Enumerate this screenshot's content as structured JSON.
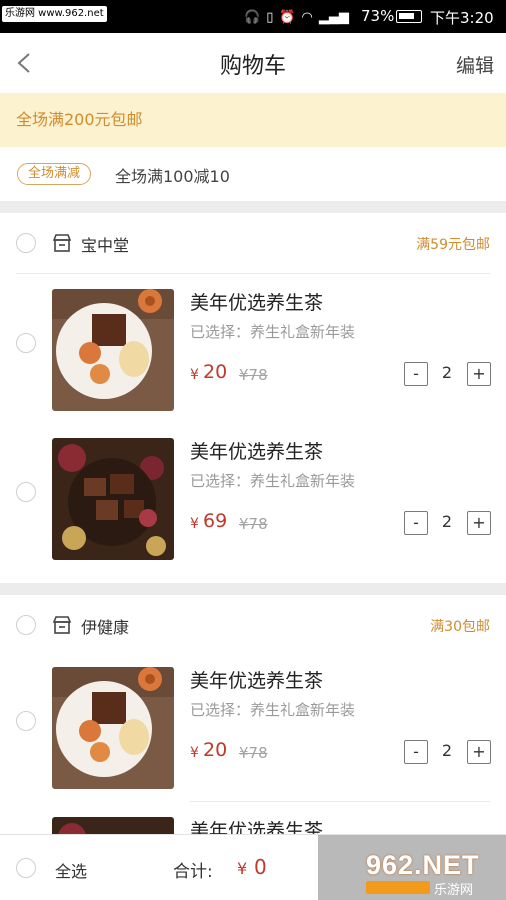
{
  "status_bar": {
    "watermark": "乐游网 www.962.net",
    "battery": "73%",
    "time": "下午3:20",
    "icons": [
      "headset-icon",
      "vibrate-icon",
      "alarm-icon",
      "wifi-icon",
      "signal-4g-icon",
      "battery-icon"
    ]
  },
  "nav": {
    "title": "购物车",
    "edit_label": "编辑"
  },
  "notice": "全场满200元包邮",
  "promo": {
    "badge": "全场满减",
    "text": "全场满100减10"
  },
  "shops": [
    {
      "name": "宝中堂",
      "shipping": "满59元包邮",
      "items": [
        {
          "title": "美年优选养生茶",
          "option": "已选择：养生礼盒新年装",
          "currency": "¥",
          "price": "20",
          "old_price": "¥78",
          "qty": "2"
        },
        {
          "title": "美年优选养生茶",
          "option": "已选择：养生礼盒新年装",
          "currency": "¥",
          "price": "69",
          "old_price": "¥78",
          "qty": "2"
        }
      ]
    },
    {
      "name": "伊健康",
      "shipping": "满30包邮",
      "items": [
        {
          "title": "美年优选养生茶",
          "option": "已选择：养生礼盒新年装",
          "currency": "¥",
          "price": "20",
          "old_price": "¥78",
          "qty": "2"
        },
        {
          "title": "美年优选养生茶"
        }
      ]
    }
  ],
  "qty_minus": "-",
  "qty_plus": "+",
  "bottom": {
    "select_all": "全选",
    "total_label": "合计:",
    "total_currency": "¥",
    "total_value": "0"
  },
  "watermark2": {
    "main": "962.NET",
    "sub": "乐游网"
  },
  "colors": {
    "accent_price": "#c0392b",
    "notice_bg": "#fdf2cf",
    "notice_text": "#d18c2e",
    "checkout_bg": "#b9b9b9"
  }
}
